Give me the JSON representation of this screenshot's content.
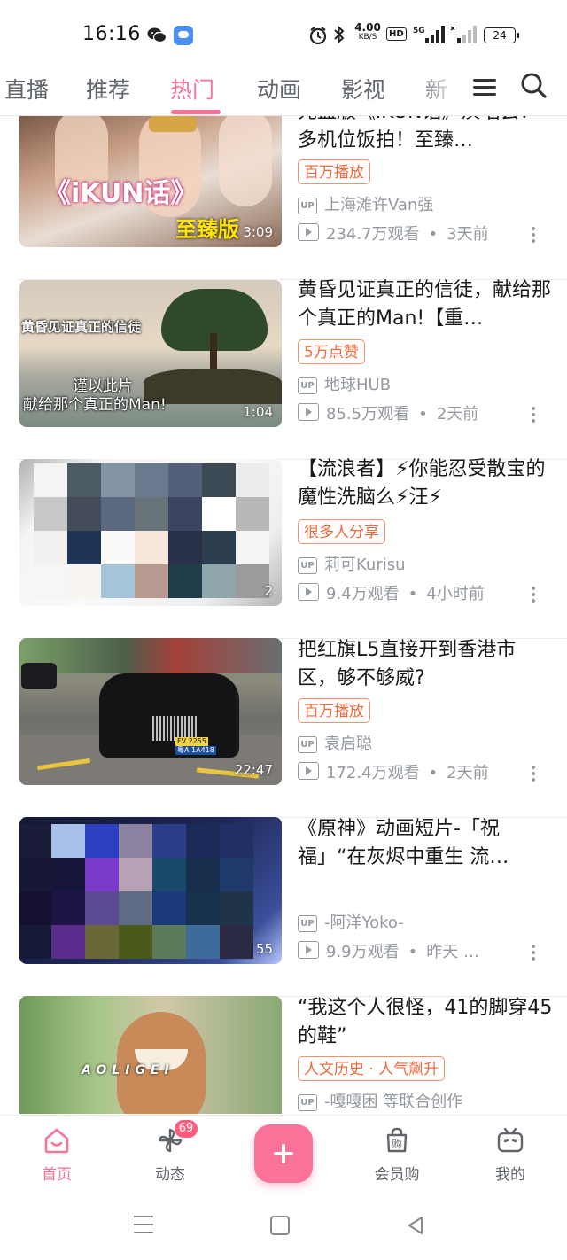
{
  "status_bar": {
    "time": "16:16",
    "net_speed_value": "4.00",
    "net_speed_unit": "KB/S",
    "hd_label": "HD",
    "signal_label": "5G",
    "battery": "24"
  },
  "tabs": [
    {
      "label": "直播"
    },
    {
      "label": "推荐"
    },
    {
      "label": "热门"
    },
    {
      "label": "动画"
    },
    {
      "label": "影视"
    },
    {
      "label": "新"
    }
  ],
  "active_tab": "热门",
  "feed": [
    {
      "title": "元盖版《iKUN话》演唱会！多机位饭拍！至臻…",
      "badge": "百万播放",
      "uploader": "上海滩许Van强",
      "views": "234.7万观看",
      "age": "3天前",
      "duration": "3:09",
      "thumb_text_1": "《iKUN话》",
      "thumb_text_2": "至臻版"
    },
    {
      "title": "黄昏见证真正的信徒，献给那个真正的Man!【重…",
      "badge": "5万点赞",
      "uploader": "地球HUB",
      "views": "85.5万观看",
      "age": "2天前",
      "duration": "1:04",
      "thumb_text_1": "黄昏见证真正的信徒",
      "thumb_text_2": "谨以此片",
      "thumb_text_3": "献给那个真正的Man!"
    },
    {
      "title": "【流浪者】⚡你能忍受散宝的魔性洗脑么⚡汪⚡",
      "badge": "很多人分享",
      "uploader": "莉可Kurisu",
      "views": "9.4万观看",
      "age": "4小时前",
      "duration": "2"
    },
    {
      "title": "把红旗L5直接开到香港市区，够不够威?",
      "badge": "百万播放",
      "uploader": "袁启聪",
      "views": "172.4万观看",
      "age": "2天前",
      "duration": "22:47",
      "plate_1": "FV 2255",
      "plate_2": "粤A 1A418"
    },
    {
      "title": "《原神》动画短片-「祝福」“在灰烬中重生 流…",
      "badge": "",
      "uploader": "-阿洋Yoko-",
      "views": "9.9万观看",
      "age": "昨天 …",
      "duration": "55"
    },
    {
      "title": "“我这个人很怪，41的脚穿45的鞋”",
      "badge": "人文历史 · 人气飙升",
      "uploader": "-嘎嘎困 等联合创作",
      "thumb_text_1": "AOLIGEI"
    }
  ],
  "bottom_nav": [
    {
      "label": "首页"
    },
    {
      "label": "动态",
      "badge": "69"
    },
    {
      "label": "会员购",
      "icon_text": "购"
    },
    {
      "label": "我的"
    }
  ],
  "colors": {
    "accent": "#fb7299",
    "badge_orange": "#f06a3d",
    "meta_gray": "#9499a0"
  }
}
